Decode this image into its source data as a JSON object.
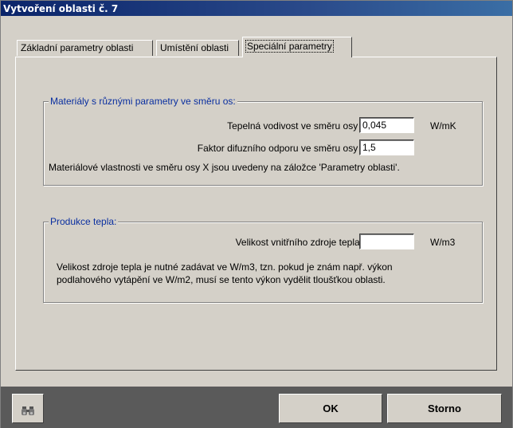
{
  "window": {
    "title": "Vytvoření oblasti č. 7"
  },
  "tabs": [
    {
      "label": "Základní parametry oblasti",
      "active": false
    },
    {
      "label": "Umístění oblasti",
      "active": false
    },
    {
      "label": "Speciální parametry",
      "active": true
    }
  ],
  "materials_group": {
    "legend": "Materiály s různými parametry ve směru os:",
    "thermal_label": "Tepelná vodivost ve směru osy Y:",
    "thermal_value": "0,045",
    "thermal_unit": "W/mK",
    "diffusion_label": "Faktor difuzního odporu ve směru osy Y:",
    "diffusion_value": "1,5",
    "note": "Materiálové vlastnosti ve směru osy X jsou uvedeny na záložce 'Parametry oblasti'."
  },
  "heat_group": {
    "legend": "Produkce tepla:",
    "source_label": "Velikost vnitřního zdroje tepla:",
    "source_value": "",
    "source_unit": "W/m3",
    "note_line1": "Velikost zdroje tepla je nutné zadávat ve W/m3, tzn. pokud je znám např. výkon",
    "note_line2": "podlahového vytápění ve W/m2, musí se tento výkon vydělit tloušťkou oblasti."
  },
  "buttons": {
    "ok": "OK",
    "cancel": "Storno",
    "find_icon": "binoculars-icon"
  },
  "colors": {
    "title_bar": "#0a246a",
    "legend_text": "#0a2fa0",
    "dialog_face": "#d4d0c8",
    "button_bar": "#5a5a5a"
  }
}
